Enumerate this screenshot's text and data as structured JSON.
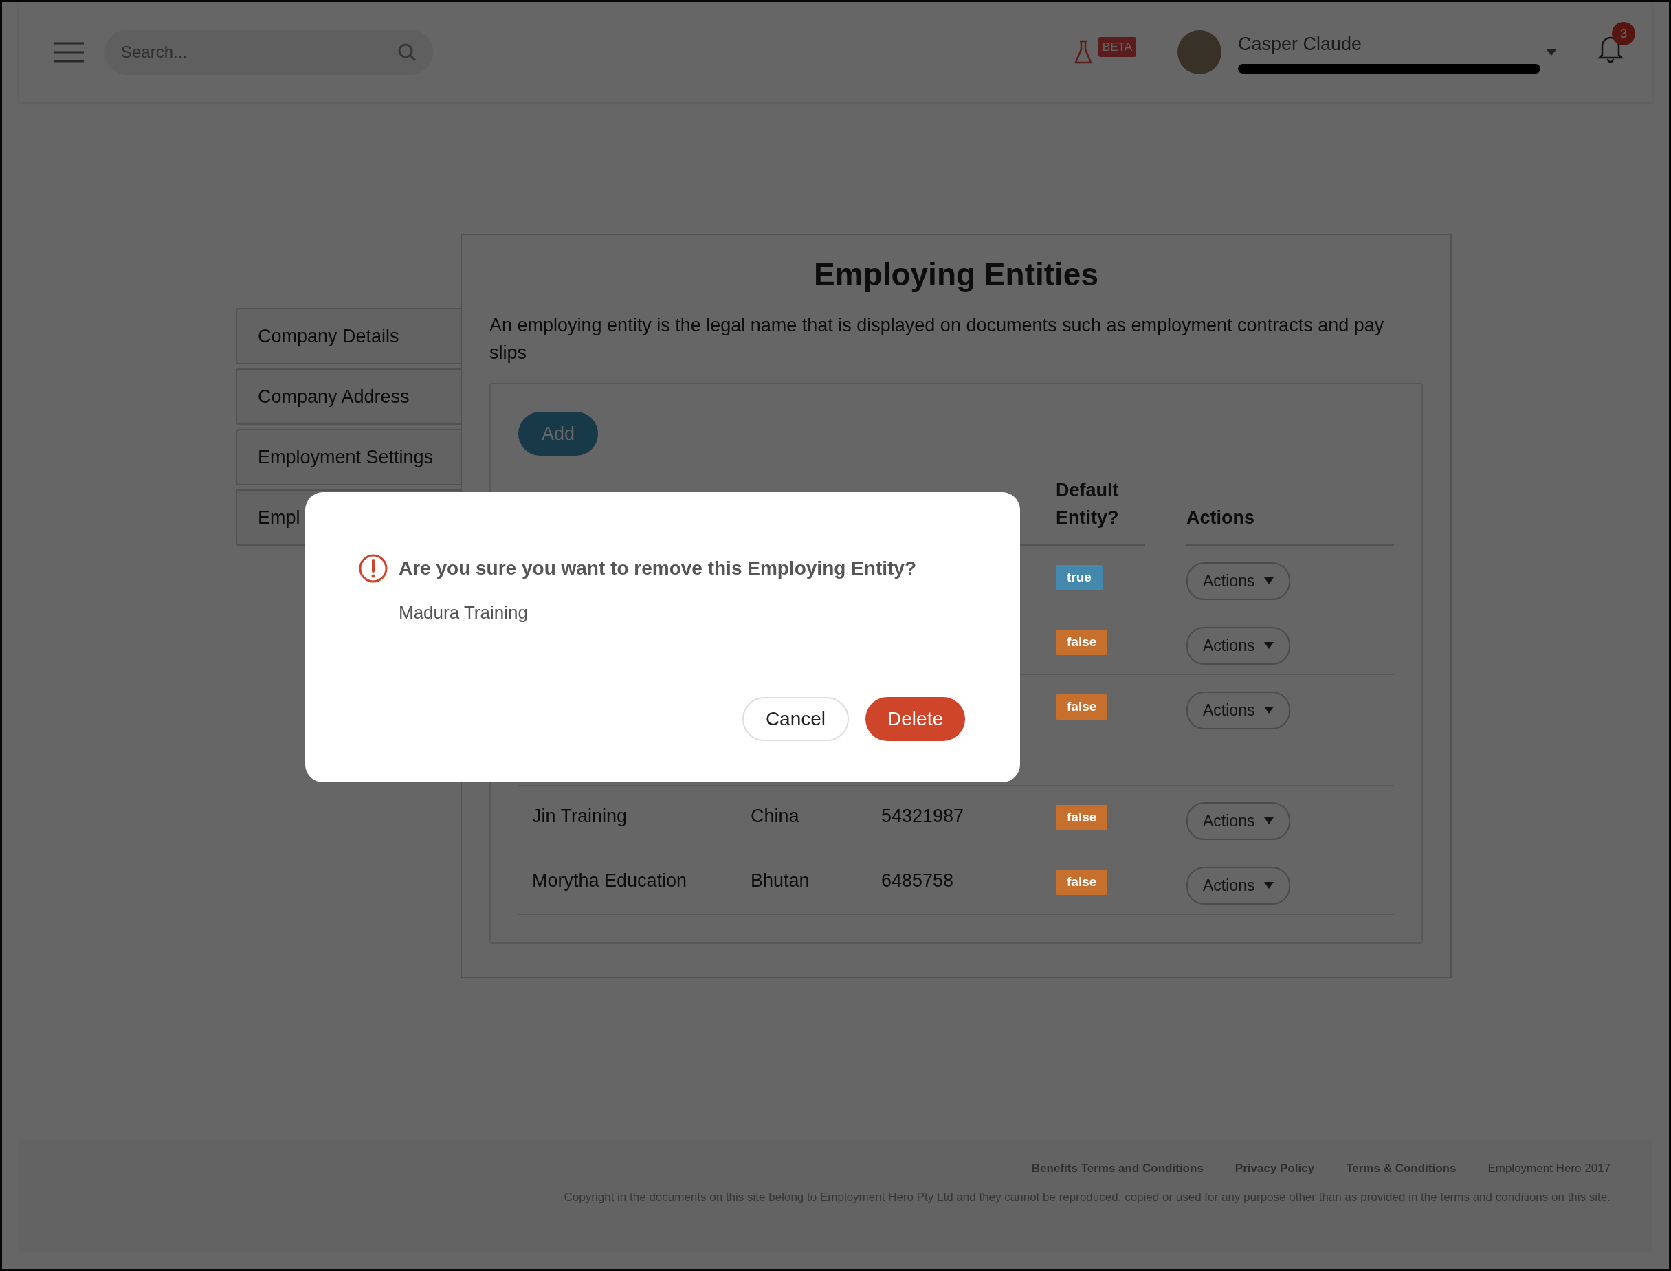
{
  "header": {
    "search": {
      "placeholder": "Search..."
    },
    "beta_badge": "BETA",
    "user": {
      "name": "Casper Claude"
    },
    "notifications": {
      "count": "3"
    }
  },
  "sidebar": {
    "items": [
      {
        "label": "Company Details"
      },
      {
        "label": "Company Address"
      },
      {
        "label": "Employment Settings"
      },
      {
        "label": "Empl"
      }
    ]
  },
  "page": {
    "title": "Employing Entities",
    "description": "An employing entity is the legal name that is displayed on documents such as employment contracts and pay slips",
    "add_button": "Add",
    "table": {
      "columns": {
        "default": "Default Entity?",
        "actions": "Actions"
      },
      "rows": [
        {
          "default": {
            "label": "true",
            "color": "#4289ad"
          },
          "actions": "Actions"
        },
        {
          "default": {
            "label": "false",
            "color": "#c7702e"
          },
          "actions": "Actions"
        },
        {
          "default": {
            "label": "false",
            "color": "#c7702e"
          },
          "actions": "Actions"
        },
        {
          "name": "Jin Training",
          "country": "China",
          "number": "54321987",
          "default": {
            "label": "false",
            "color": "#c7702e"
          },
          "actions": "Actions"
        },
        {
          "name": "Morytha Education",
          "country": "Bhutan",
          "number": "6485758",
          "default": {
            "label": "false",
            "color": "#c7702e"
          },
          "actions": "Actions"
        }
      ]
    }
  },
  "footer": {
    "links": [
      "Benefits Terms and Conditions",
      "Privacy Policy",
      "Terms & Conditions"
    ],
    "brand": "Employment Hero 2017",
    "copyright": "Copyright in the documents on this site belong to Employment Hero Pty Ltd and they cannot be reproduced, copied or used for any purpose other than as provided in the terms and conditions on this site."
  },
  "modal": {
    "title": "Are you sure you want to remove this Employing Entity?",
    "entity": "Madura Training",
    "buttons": [
      {
        "label": "Cancel",
        "kind": "secondary"
      },
      {
        "label": "Delete",
        "kind": "danger"
      }
    ]
  }
}
